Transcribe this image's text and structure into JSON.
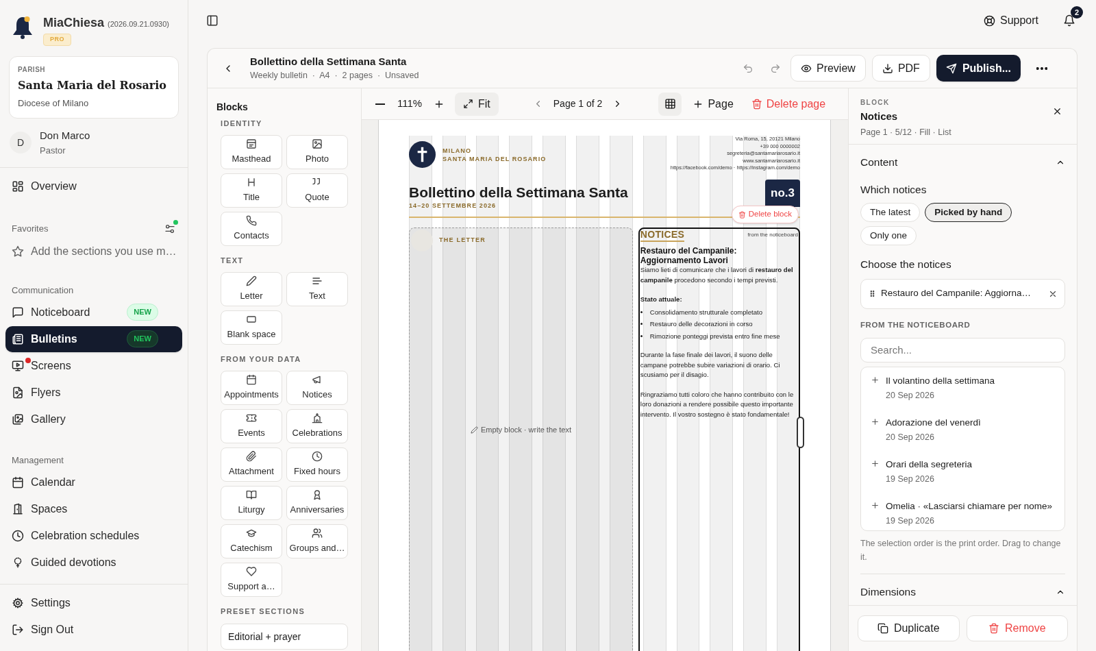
{
  "app": {
    "name": "MiaChiesa",
    "version": "(2026.09.21.0930)",
    "plan": "PRO"
  },
  "parish": {
    "label": "PARISH",
    "name": "Santa Maria del Rosario",
    "diocese": "Diocese of Milano"
  },
  "user": {
    "initial": "D",
    "name": "Don Marco",
    "role": "Pastor"
  },
  "nav": {
    "top": [
      {
        "label": "Overview",
        "selected": false
      }
    ],
    "favorites": {
      "title": "Favorites",
      "hint": "Add the sections you use m…"
    },
    "sections": [
      {
        "title": "Communication",
        "items": [
          {
            "label": "Noticeboard",
            "badge": "NEW",
            "selected": false,
            "alert": false
          },
          {
            "label": "Bulletins",
            "badge": "NEW",
            "selected": true,
            "alert": false
          },
          {
            "label": "Screens",
            "selected": false,
            "alert": true
          },
          {
            "label": "Flyers",
            "selected": false,
            "alert": false
          },
          {
            "label": "Gallery",
            "selected": false,
            "alert": false
          }
        ]
      },
      {
        "title": "Management",
        "items": [
          {
            "label": "Calendar",
            "selected": false,
            "alert": false
          },
          {
            "label": "Spaces",
            "selected": false,
            "alert": false
          },
          {
            "label": "Celebration schedules",
            "selected": false,
            "alert": false
          },
          {
            "label": "Guided devotions",
            "selected": false,
            "alert": false
          }
        ]
      }
    ],
    "footer": [
      {
        "label": "Settings",
        "selected": false
      },
      {
        "label": "Sign Out",
        "selected": false
      }
    ]
  },
  "topbar": {
    "support": "Support",
    "notifications": "2"
  },
  "editor": {
    "title": "Bollettino della Settimana Santa",
    "meta": "Weekly bulletin  ·  A4  ·  2 pages  ·  Unsaved",
    "preview": "Preview",
    "pdf": "PDF",
    "publish": "Publish..."
  },
  "toolbar": {
    "zoom": "111%",
    "fit": "Fit",
    "page": "Page 1 of 2",
    "show_grid": true,
    "add_page": "Page",
    "delete_page": "Delete page"
  },
  "blocks": {
    "title": "Blocks",
    "groups": [
      {
        "title": "IDENTITY",
        "items": [
          "Masthead",
          "Photo",
          "Title",
          "Quote",
          "Contacts"
        ]
      },
      {
        "title": "TEXT",
        "items": [
          "Letter",
          "Text",
          "Blank space"
        ]
      },
      {
        "title": "FROM YOUR DATA",
        "items": [
          "Appointments",
          "Notices",
          "Events",
          "Celebrations",
          "Attachment",
          "Fixed hours",
          "Liturgy",
          "Anniversaries",
          "Catechism",
          "Groups and…",
          "Support a…"
        ]
      }
    ],
    "presets_title": "PRESET SECTIONS",
    "presets": [
      "Editorial + prayer"
    ]
  },
  "document": {
    "city": "MILANO",
    "parish": "SANTA MARIA DEL ROSARIO",
    "contacts": [
      "Via Roma, 15, 20121 Milano",
      "+39 000 0000002",
      "segreteria@santamariarosario.it",
      "www.santamariarosario.it",
      "https://facebook.com/demo · https://instagram.com/demo"
    ],
    "title": "Bollettino della Settimana Santa",
    "dates": "14–20 SETTEMBRE 2026",
    "issue": "no.3",
    "delete_block": "Delete block",
    "letter": {
      "heading": "THE LETTER",
      "hint": "Empty block · write the text",
      "selected": false
    },
    "notices": {
      "heading": "NOTICES",
      "source": "from the noticeboard",
      "selected": true,
      "title": "Restauro del Campanile: Aggiornamento Lavori",
      "body": [
        {
          "kind": "paragraph",
          "text": "Siamo lieti di comunicare che i lavori di **restauro del campanile** procedono secondo i tempi previsti."
        },
        {
          "kind": "heading",
          "text": "Stato attuale:"
        },
        {
          "kind": "list",
          "items": [
            "Consolidamento strutturale completato",
            "Restauro delle decorazioni in corso",
            "Rimozione ponteggi prevista entro fine mese"
          ]
        },
        {
          "kind": "paragraph",
          "text": "Durante la fase finale dei lavori, il suono delle campane potrebbe subire variazioni di orario. Ci scusiamo per il disagio."
        },
        {
          "kind": "paragraph",
          "text": "Ringraziamo tutti coloro che hanno contribuito con le loro donazioni a rendere possibile questo importante intervento. Il vostro sostegno è stato fondamentale!"
        }
      ]
    }
  },
  "inspector": {
    "label": "BLOCK",
    "title": "Notices",
    "meta": "Page 1 · 5/12 · Fill · List",
    "content": {
      "title": "Content",
      "expanded": true,
      "which_label": "Which notices",
      "modes": [
        {
          "label": "The latest",
          "selected": false
        },
        {
          "label": "Picked by hand",
          "selected": true
        },
        {
          "label": "Only one",
          "selected": false
        }
      ],
      "choose_label": "Choose the notices",
      "chosen": [
        "Restauro del Campanile: Aggiorna…"
      ],
      "source_label": "FROM THE NOTICEBOARD",
      "search_placeholder": "Search...",
      "available": [
        {
          "title": "Il volantino della settimana",
          "date": "20 Sep 2026"
        },
        {
          "title": "Adorazione del venerdì",
          "date": "20 Sep 2026"
        },
        {
          "title": "Orari della segreteria",
          "date": "19 Sep 2026"
        },
        {
          "title": "Omelia · «Lasciarsi chiamare per nome»",
          "date": "19 Sep 2026"
        }
      ],
      "note": "The selection order is the print order. Drag to change it."
    },
    "dimensions": {
      "title": "Dimensions",
      "expanded": true
    },
    "duplicate": "Duplicate",
    "remove": "Remove"
  }
}
